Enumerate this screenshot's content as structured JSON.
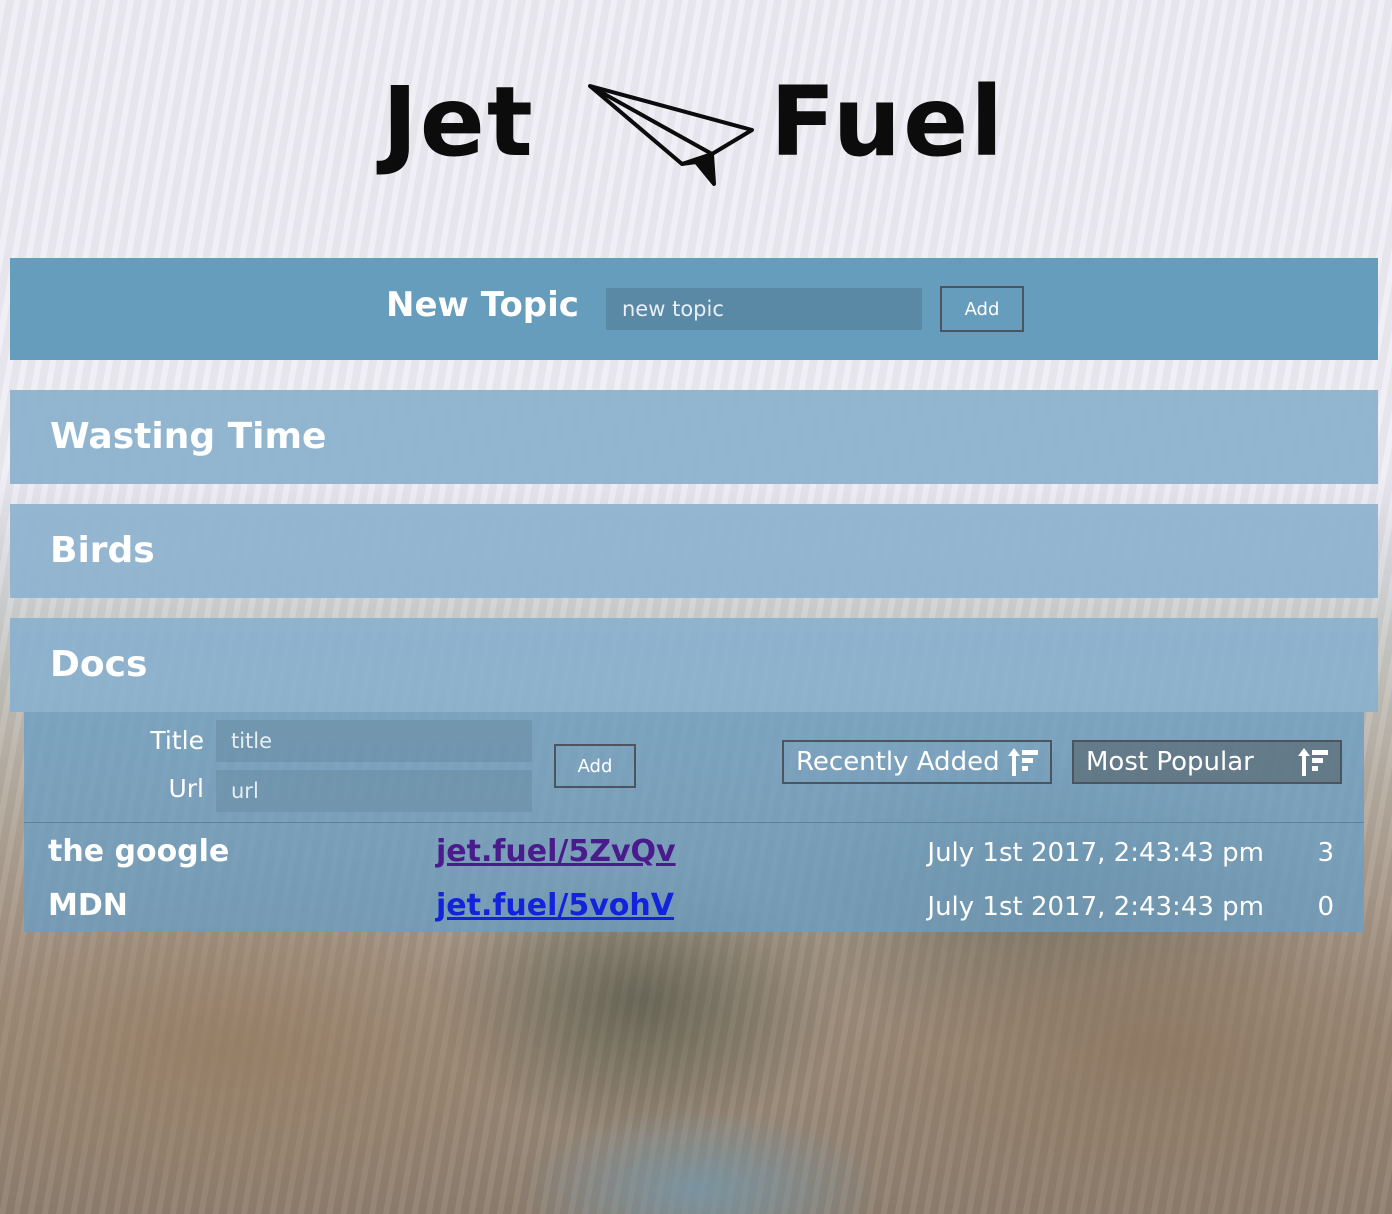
{
  "app": {
    "logo_left": "Jet",
    "logo_right": "Fuel"
  },
  "new_topic": {
    "title": "New Topic",
    "input_placeholder": "new topic",
    "add_label": "Add"
  },
  "topics": [
    {
      "title": "Wasting Time"
    },
    {
      "title": "Birds"
    },
    {
      "title": "Docs"
    }
  ],
  "docs_form": {
    "title_label": "Title",
    "title_placeholder": "title",
    "url_label": "Url",
    "url_placeholder": "url",
    "add_label": "Add"
  },
  "sort": {
    "recently_added": "Recently Added",
    "most_popular": "Most Popular",
    "icon": "sort-descending-icon"
  },
  "links": [
    {
      "title": "the google",
      "short_url": "jet.fuel/5ZvQv",
      "date": "July 1st 2017, 2:43:43 pm",
      "count": "3"
    },
    {
      "title": "MDN",
      "short_url": "jet.fuel/5vohV",
      "date": "July 1st 2017, 2:43:43 pm",
      "count": "0"
    }
  ],
  "colors": {
    "header_bar": "#669dbd",
    "topic_bar": "#8db2ce",
    "visited_link": "#4a1b8c",
    "link": "#1222dd"
  }
}
